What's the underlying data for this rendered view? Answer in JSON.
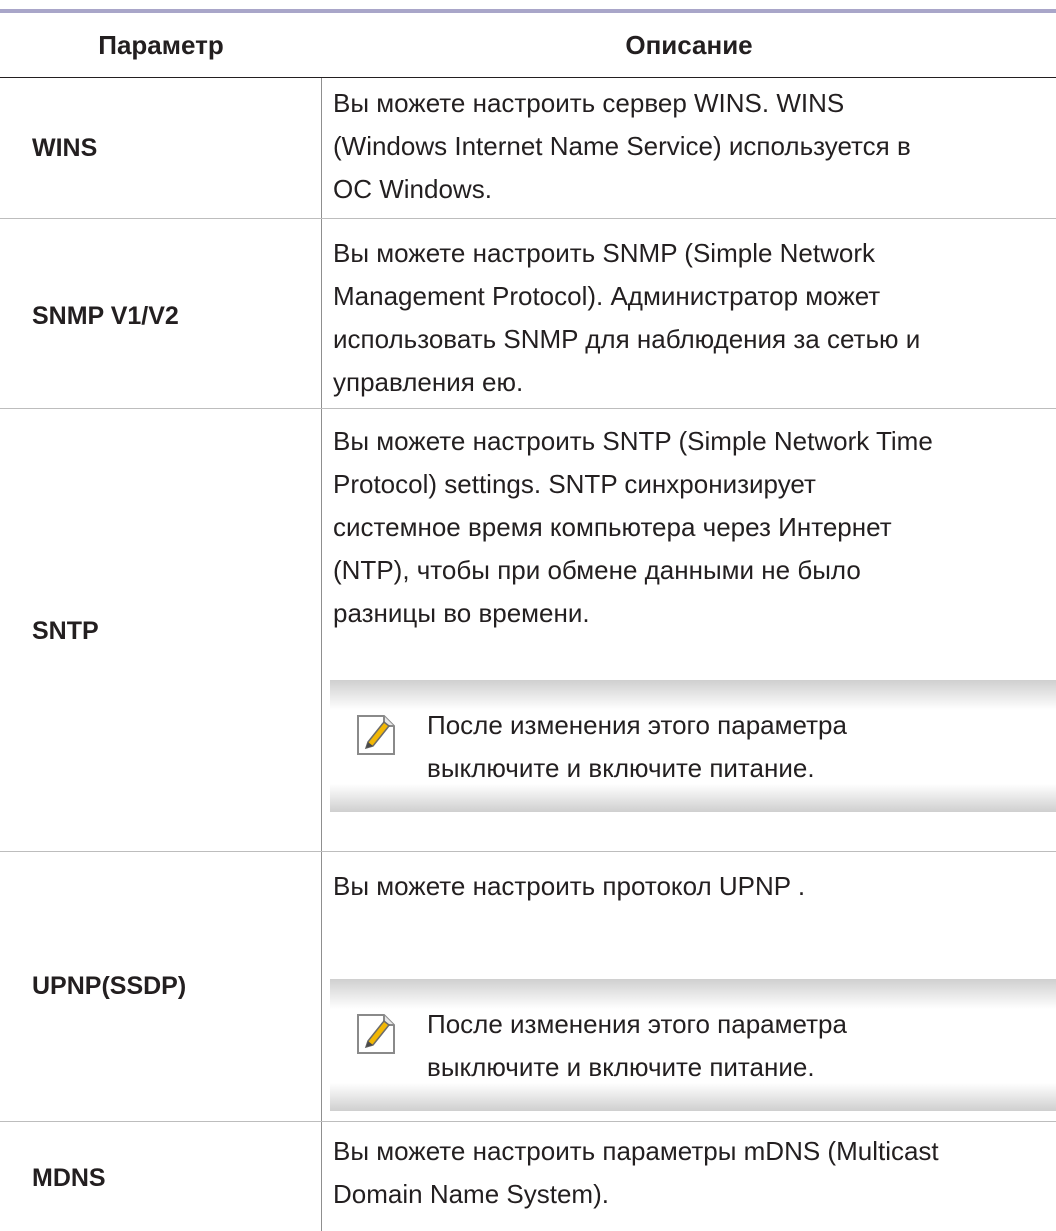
{
  "table": {
    "headers": {
      "parameter": "Параметр",
      "description": "Описание"
    },
    "rows": [
      {
        "name": "WINS",
        "description_lines": [
          "Вы можете настроить сервер WINS. WINS",
          "(Windows Internet Name Service) используется в",
          "ОС Windows."
        ]
      },
      {
        "name": "SNMP V1/V2",
        "description_lines": [
          "Вы можете настроить SNMP (Simple Network",
          "Management Protocol). Администратор может",
          "использовать SNMP для наблюдения за сетью и",
          "управления ею."
        ]
      },
      {
        "name": "SNTP",
        "description_lines": [
          "Вы можете настроить SNTP (Simple Network Time",
          "Protocol) settings. SNTP синхронизирует",
          "системное время компьютера через Интернет",
          "(NTP), чтобы при обмене данными не было",
          "разницы во времени."
        ],
        "note_lines": [
          "После изменения этого параметра",
          "выключите и включите питание."
        ],
        "note_icon": "note-pencil-icon"
      },
      {
        "name": "UPNP(SSDP)",
        "description_lines": [
          "Вы можете настроить протокол UPNP ."
        ],
        "note_lines": [
          "После изменения этого параметра",
          "выключите и включите питание."
        ],
        "note_icon": "note-pencil-icon"
      },
      {
        "name": "MDNS",
        "description_lines": [
          "Вы можете настроить параметры mDNS (Multicast",
          "Domain Name System)."
        ]
      }
    ]
  },
  "colors": {
    "header_rule": "#a9a6c9",
    "text": "#231f20",
    "note_icon_accent": "#f2b705"
  }
}
